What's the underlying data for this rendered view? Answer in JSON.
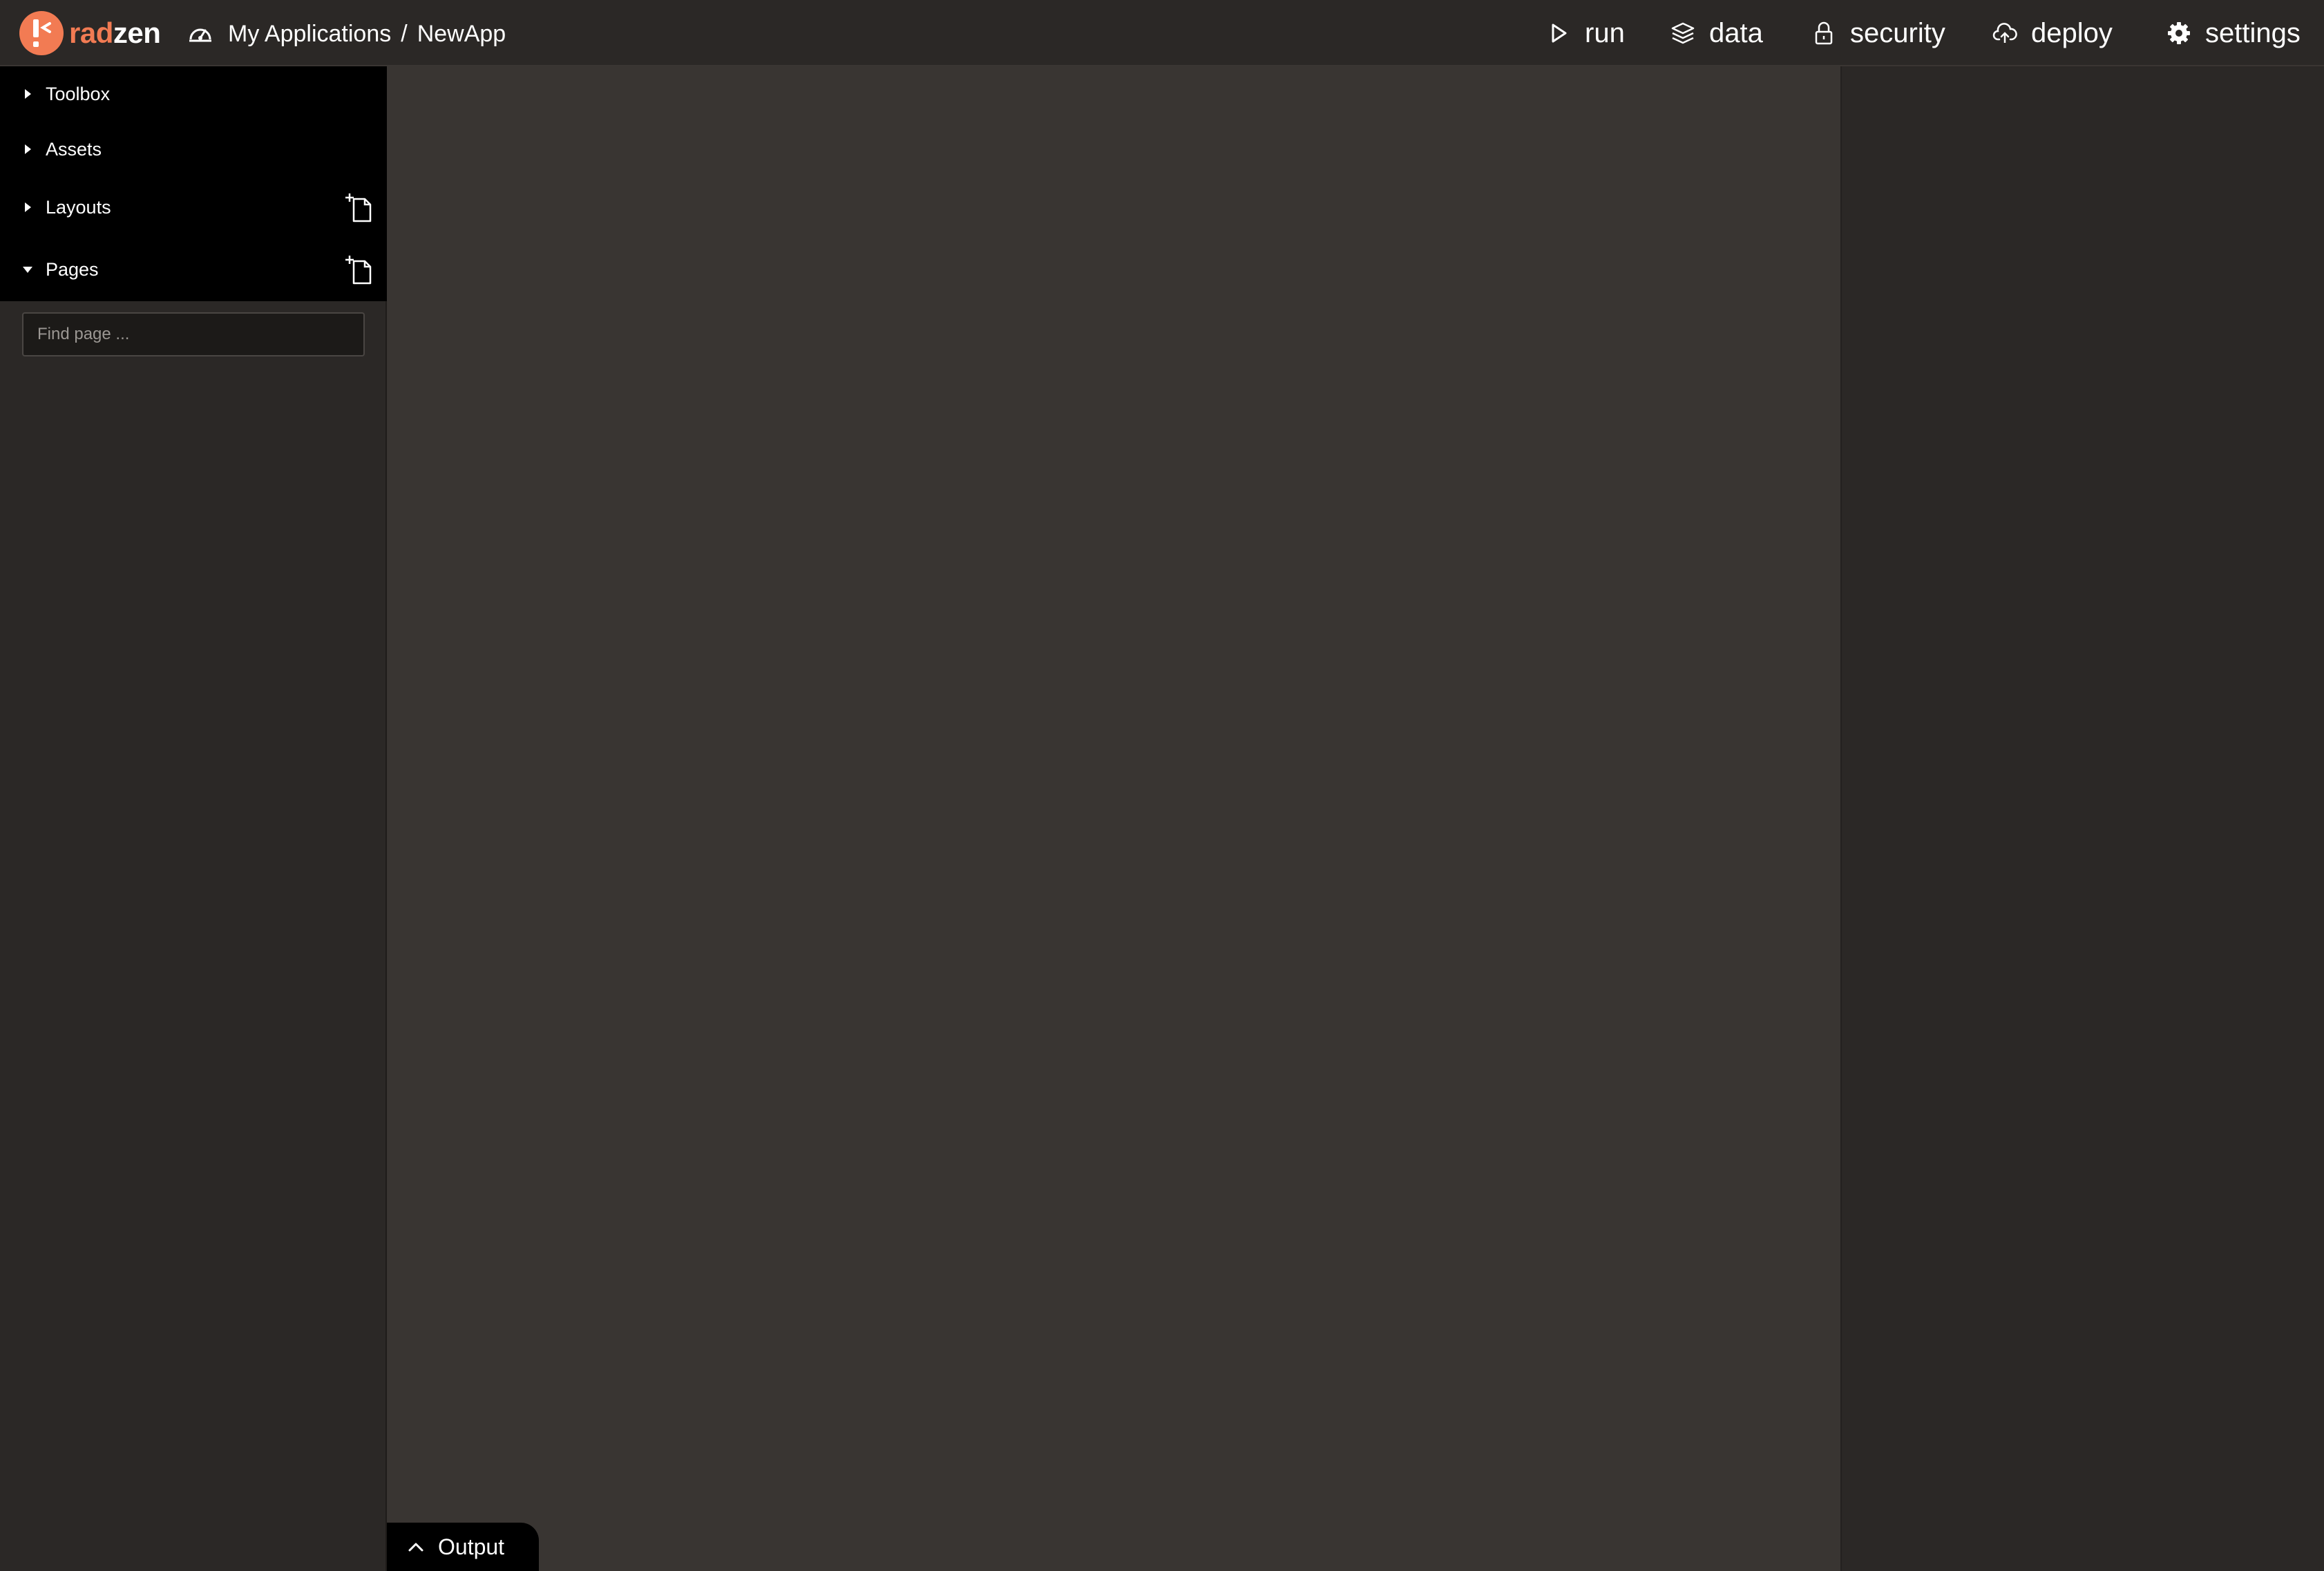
{
  "brand": {
    "name_part1": "rad",
    "name_part2": "zen",
    "accent_color": "#f27b53"
  },
  "breadcrumb": {
    "icon": "dashboard-icon",
    "root": "My Applications",
    "separator": "/",
    "current": "NewApp"
  },
  "topnav": [
    {
      "label": "run",
      "icon": "play-icon"
    },
    {
      "label": "data",
      "icon": "layers-icon"
    },
    {
      "label": "security",
      "icon": "lock-icon"
    },
    {
      "label": "deploy",
      "icon": "cloud-upload-icon"
    },
    {
      "label": "settings",
      "icon": "gear-icon"
    }
  ],
  "sidebar": {
    "sections": [
      {
        "label": "Toolbox",
        "expanded": false
      },
      {
        "label": "Assets",
        "expanded": false
      },
      {
        "label": "Layouts",
        "expanded": false,
        "has_add": true
      },
      {
        "label": "Pages",
        "expanded": true,
        "has_add": true
      }
    ],
    "search_placeholder": "Find page ..."
  },
  "output_panel": {
    "label": "Output",
    "icon": "chevron-up-icon"
  },
  "colors": {
    "topbar_bg": "#2b2826",
    "canvas_bg": "#393532",
    "sidebar_header_bg": "#000000"
  }
}
